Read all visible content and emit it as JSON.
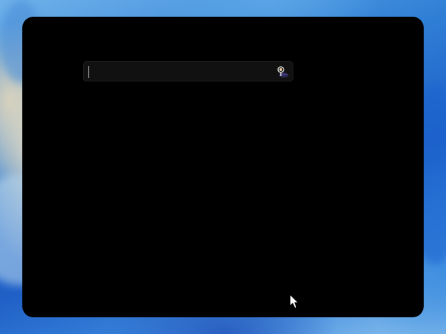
{
  "desktop": {
    "wallpaper": "blue-bloom-wallpaper",
    "accent": "#2f7fd6"
  },
  "window": {
    "background": "#000000",
    "search": {
      "value": "",
      "placeholder": "",
      "focused": true,
      "icon": "search-person-icon"
    }
  },
  "pointer": {
    "icon": "arrow-cursor-icon"
  }
}
